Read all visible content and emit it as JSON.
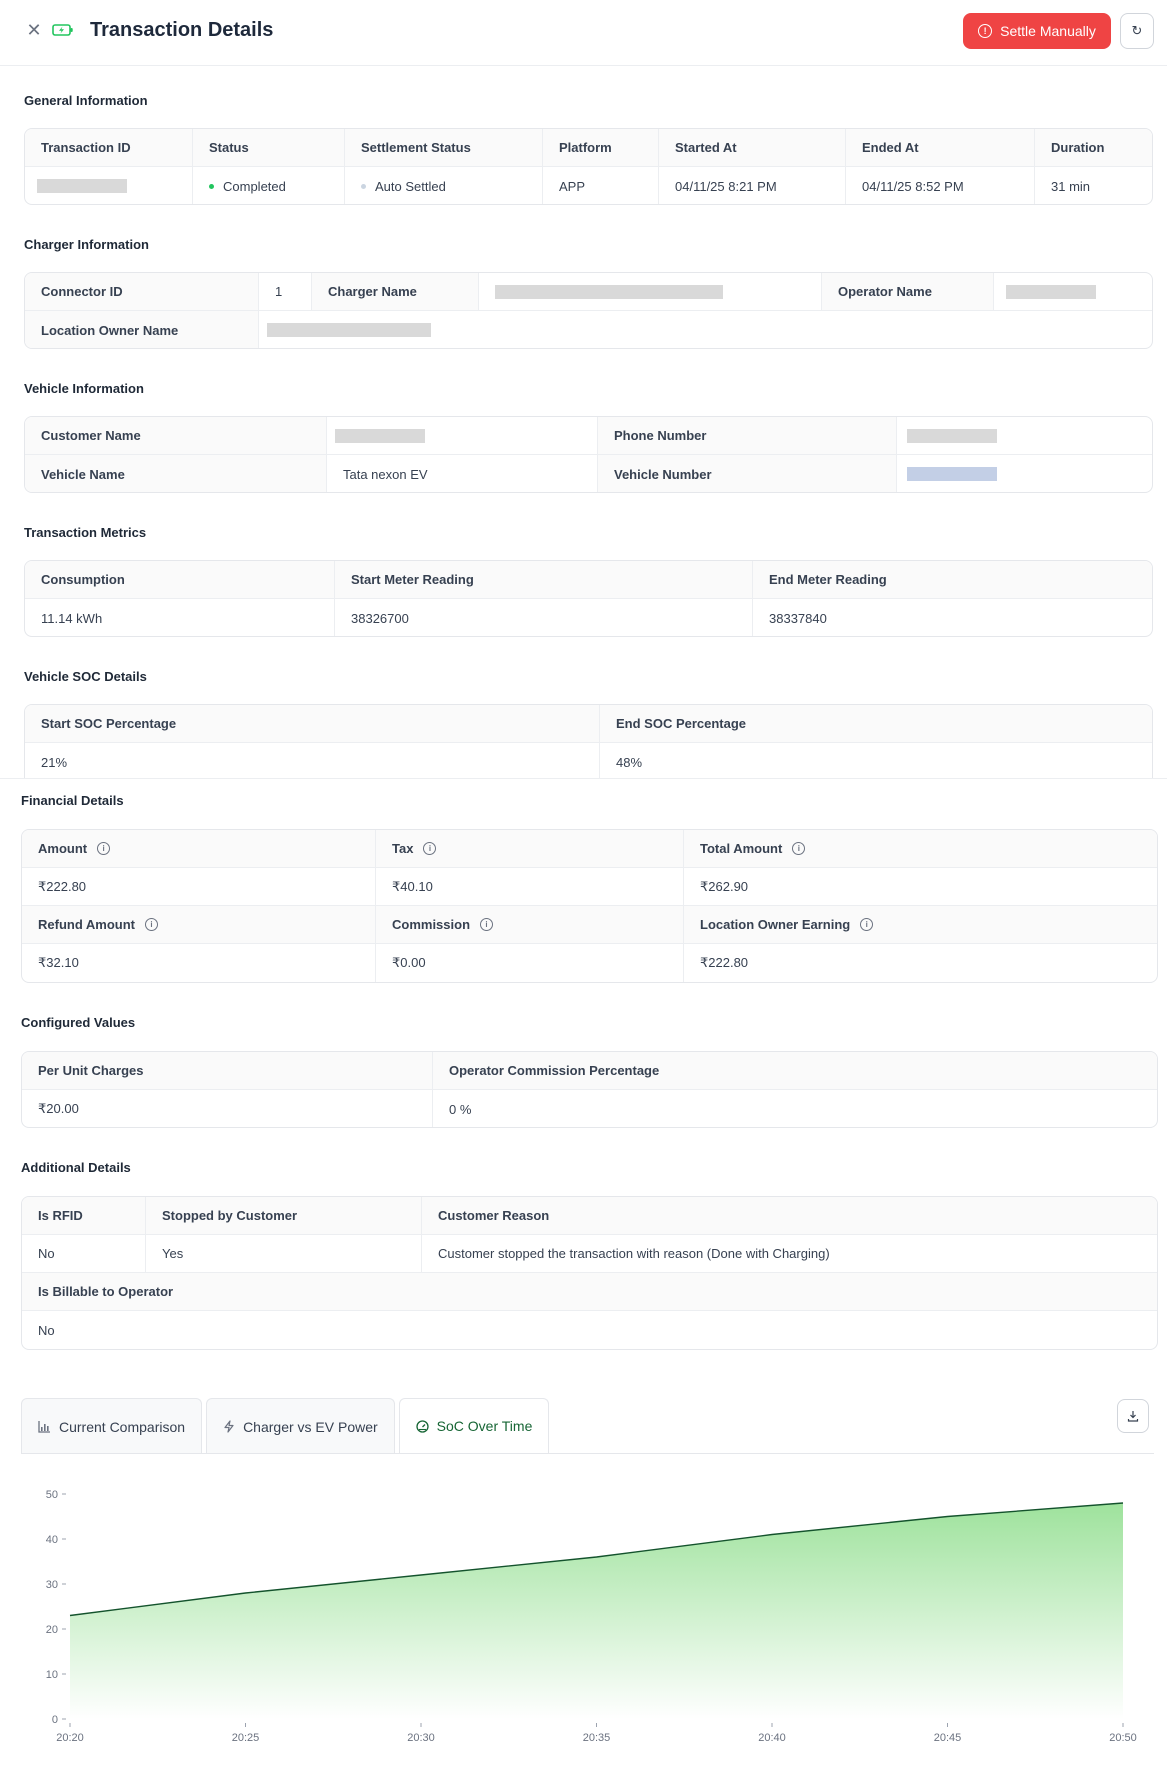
{
  "header": {
    "title": "Transaction Details",
    "settle_label": "Settle Manually"
  },
  "sections": {
    "general": "General Information",
    "charger": "Charger Information",
    "vehicle": "Vehicle Information",
    "metrics": "Transaction Metrics",
    "soc": "Vehicle SOC Details",
    "financial": "Financial Details",
    "configured": "Configured Values",
    "additional": "Additional Details"
  },
  "general": {
    "headers": [
      "Transaction ID",
      "Status",
      "Settlement Status",
      "Platform",
      "Started At",
      "Ended At",
      "Duration"
    ],
    "status": "Completed",
    "settlement_status": "Auto Settled",
    "platform": "APP",
    "started_at": "04/11/25 8:21 PM",
    "ended_at": "04/11/25 8:52 PM",
    "duration": "31 min",
    "colors": {
      "completed_dot": "#22c55e",
      "settled_dot": "#cbd5e1"
    }
  },
  "charger": {
    "connector_id_label": "Connector ID",
    "connector_id": "1",
    "charger_name_label": "Charger Name",
    "operator_name_label": "Operator Name",
    "location_owner_label": "Location Owner Name"
  },
  "vehicle": {
    "customer_name_label": "Customer Name",
    "phone_label": "Phone Number",
    "vehicle_name_label": "Vehicle Name",
    "vehicle_name": "Tata nexon EV",
    "vehicle_number_label": "Vehicle Number"
  },
  "metrics": {
    "headers": [
      "Consumption",
      "Start Meter Reading",
      "End Meter Reading"
    ],
    "values": [
      "11.14 kWh",
      "38326700",
      "38337840"
    ]
  },
  "soc": {
    "headers": [
      "Start SOC Percentage",
      "End SOC Percentage"
    ],
    "values": [
      "21%",
      "48%"
    ]
  },
  "financial": {
    "row1_labels": [
      "Amount",
      "Tax",
      "Total Amount"
    ],
    "row1_values": [
      "₹222.80",
      "₹40.10",
      "₹262.90"
    ],
    "row2_labels": [
      "Refund Amount",
      "Commission",
      "Location Owner Earning"
    ],
    "row2_values": [
      "₹32.10",
      "₹0.00",
      "₹222.80"
    ]
  },
  "configured": {
    "headers": [
      "Per Unit Charges",
      "Operator Commission Percentage"
    ],
    "values": [
      "₹20.00",
      "0 %"
    ]
  },
  "additional": {
    "headers": [
      "Is RFID",
      "Stopped by Customer",
      "Customer Reason"
    ],
    "values": [
      "No",
      "Yes",
      "Customer stopped the transaction with reason (Done with Charging)"
    ],
    "billable_label": "Is Billable to Operator",
    "billable_value": "No"
  },
  "tabs": [
    {
      "label": "Current Comparison",
      "icon": "bar-chart-icon"
    },
    {
      "label": "Charger vs EV Power",
      "icon": "bolt-icon"
    },
    {
      "label": "SoC Over Time",
      "icon": "gauge-icon"
    }
  ],
  "chart_data": {
    "type": "area",
    "x": [
      "20:20",
      "20:25",
      "20:30",
      "20:35",
      "20:40",
      "20:45",
      "20:50"
    ],
    "values": [
      23,
      28,
      32,
      36,
      41,
      45,
      48
    ],
    "yticks": [
      0,
      10,
      20,
      30,
      40,
      50
    ],
    "ylim": [
      0,
      50
    ],
    "grid": false,
    "colors": {
      "line": "#14532d",
      "fill_top": "#9ee29c",
      "fill_bottom": "#ffffff"
    }
  }
}
